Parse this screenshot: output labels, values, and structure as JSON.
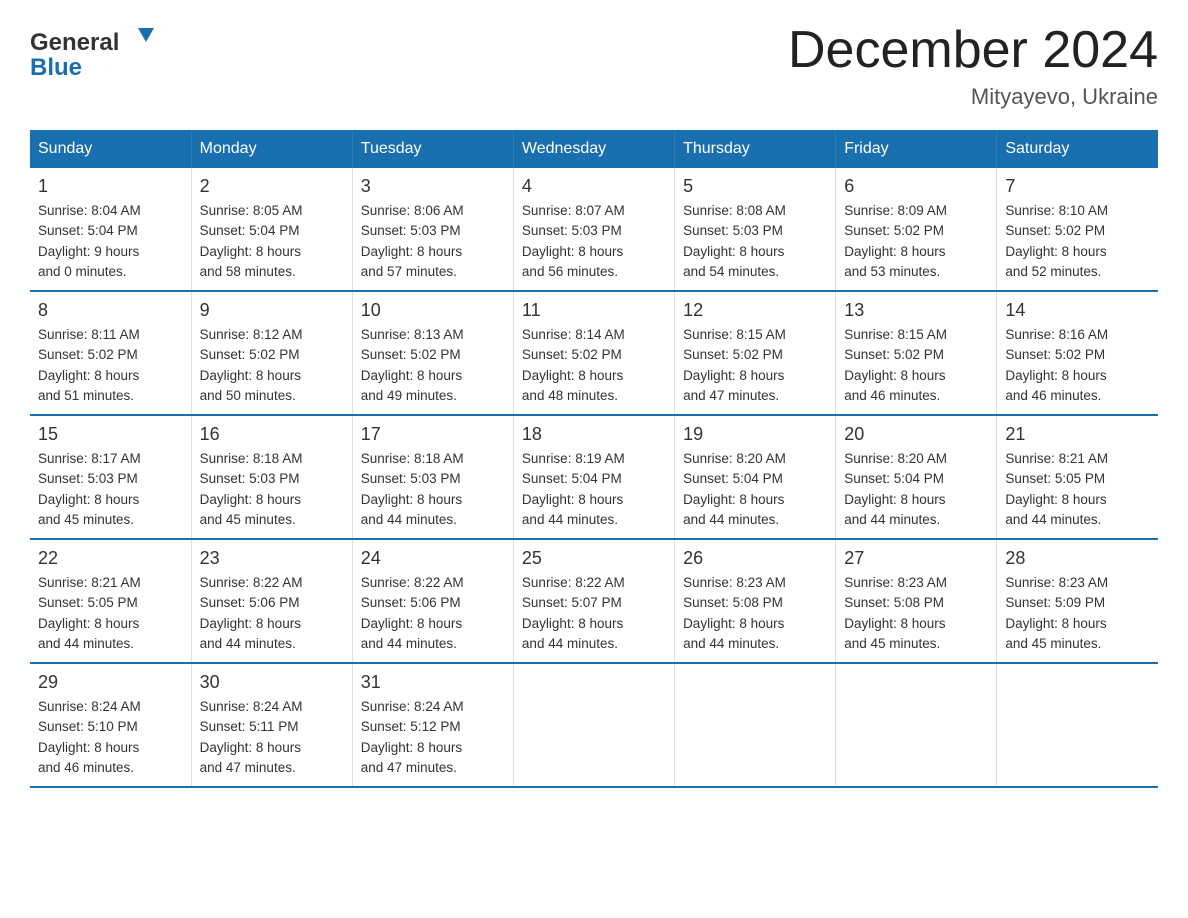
{
  "header": {
    "title": "December 2024",
    "subtitle": "Mityayevo, Ukraine",
    "logo_general": "General",
    "logo_blue": "Blue"
  },
  "days_of_week": [
    "Sunday",
    "Monday",
    "Tuesday",
    "Wednesday",
    "Thursday",
    "Friday",
    "Saturday"
  ],
  "weeks": [
    [
      {
        "day": "1",
        "sunrise": "8:04 AM",
        "sunset": "5:04 PM",
        "daylight": "9 hours and 0 minutes"
      },
      {
        "day": "2",
        "sunrise": "8:05 AM",
        "sunset": "5:04 PM",
        "daylight": "8 hours and 58 minutes"
      },
      {
        "day": "3",
        "sunrise": "8:06 AM",
        "sunset": "5:03 PM",
        "daylight": "8 hours and 57 minutes"
      },
      {
        "day": "4",
        "sunrise": "8:07 AM",
        "sunset": "5:03 PM",
        "daylight": "8 hours and 56 minutes"
      },
      {
        "day": "5",
        "sunrise": "8:08 AM",
        "sunset": "5:03 PM",
        "daylight": "8 hours and 54 minutes"
      },
      {
        "day": "6",
        "sunrise": "8:09 AM",
        "sunset": "5:02 PM",
        "daylight": "8 hours and 53 minutes"
      },
      {
        "day": "7",
        "sunrise": "8:10 AM",
        "sunset": "5:02 PM",
        "daylight": "8 hours and 52 minutes"
      }
    ],
    [
      {
        "day": "8",
        "sunrise": "8:11 AM",
        "sunset": "5:02 PM",
        "daylight": "8 hours and 51 minutes"
      },
      {
        "day": "9",
        "sunrise": "8:12 AM",
        "sunset": "5:02 PM",
        "daylight": "8 hours and 50 minutes"
      },
      {
        "day": "10",
        "sunrise": "8:13 AM",
        "sunset": "5:02 PM",
        "daylight": "8 hours and 49 minutes"
      },
      {
        "day": "11",
        "sunrise": "8:14 AM",
        "sunset": "5:02 PM",
        "daylight": "8 hours and 48 minutes"
      },
      {
        "day": "12",
        "sunrise": "8:15 AM",
        "sunset": "5:02 PM",
        "daylight": "8 hours and 47 minutes"
      },
      {
        "day": "13",
        "sunrise": "8:15 AM",
        "sunset": "5:02 PM",
        "daylight": "8 hours and 46 minutes"
      },
      {
        "day": "14",
        "sunrise": "8:16 AM",
        "sunset": "5:02 PM",
        "daylight": "8 hours and 46 minutes"
      }
    ],
    [
      {
        "day": "15",
        "sunrise": "8:17 AM",
        "sunset": "5:03 PM",
        "daylight": "8 hours and 45 minutes"
      },
      {
        "day": "16",
        "sunrise": "8:18 AM",
        "sunset": "5:03 PM",
        "daylight": "8 hours and 45 minutes"
      },
      {
        "day": "17",
        "sunrise": "8:18 AM",
        "sunset": "5:03 PM",
        "daylight": "8 hours and 44 minutes"
      },
      {
        "day": "18",
        "sunrise": "8:19 AM",
        "sunset": "5:04 PM",
        "daylight": "8 hours and 44 minutes"
      },
      {
        "day": "19",
        "sunrise": "8:20 AM",
        "sunset": "5:04 PM",
        "daylight": "8 hours and 44 minutes"
      },
      {
        "day": "20",
        "sunrise": "8:20 AM",
        "sunset": "5:04 PM",
        "daylight": "8 hours and 44 minutes"
      },
      {
        "day": "21",
        "sunrise": "8:21 AM",
        "sunset": "5:05 PM",
        "daylight": "8 hours and 44 minutes"
      }
    ],
    [
      {
        "day": "22",
        "sunrise": "8:21 AM",
        "sunset": "5:05 PM",
        "daylight": "8 hours and 44 minutes"
      },
      {
        "day": "23",
        "sunrise": "8:22 AM",
        "sunset": "5:06 PM",
        "daylight": "8 hours and 44 minutes"
      },
      {
        "day": "24",
        "sunrise": "8:22 AM",
        "sunset": "5:06 PM",
        "daylight": "8 hours and 44 minutes"
      },
      {
        "day": "25",
        "sunrise": "8:22 AM",
        "sunset": "5:07 PM",
        "daylight": "8 hours and 44 minutes"
      },
      {
        "day": "26",
        "sunrise": "8:23 AM",
        "sunset": "5:08 PM",
        "daylight": "8 hours and 44 minutes"
      },
      {
        "day": "27",
        "sunrise": "8:23 AM",
        "sunset": "5:08 PM",
        "daylight": "8 hours and 45 minutes"
      },
      {
        "day": "28",
        "sunrise": "8:23 AM",
        "sunset": "5:09 PM",
        "daylight": "8 hours and 45 minutes"
      }
    ],
    [
      {
        "day": "29",
        "sunrise": "8:24 AM",
        "sunset": "5:10 PM",
        "daylight": "8 hours and 46 minutes"
      },
      {
        "day": "30",
        "sunrise": "8:24 AM",
        "sunset": "5:11 PM",
        "daylight": "8 hours and 47 minutes"
      },
      {
        "day": "31",
        "sunrise": "8:24 AM",
        "sunset": "5:12 PM",
        "daylight": "8 hours and 47 minutes"
      },
      null,
      null,
      null,
      null
    ]
  ]
}
